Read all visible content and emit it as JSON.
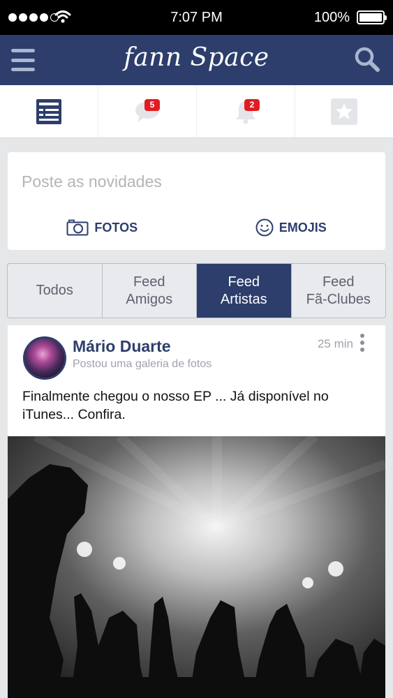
{
  "status_bar": {
    "time": "7:07 PM",
    "battery": "100%"
  },
  "header": {
    "title": "fann Space",
    "menu_icon": "hamburger-menu-icon",
    "search_icon": "search-icon"
  },
  "top_tabs": [
    {
      "name": "feed",
      "icon": "news-feed-icon",
      "badge": ""
    },
    {
      "name": "messages",
      "icon": "chat-bubble-icon",
      "badge": "5"
    },
    {
      "name": "notifications",
      "icon": "bell-icon",
      "badge": "2"
    },
    {
      "name": "favorites",
      "icon": "star-icon",
      "badge": ""
    }
  ],
  "composer": {
    "placeholder": "Poste as novidades",
    "photos_label": "FOTOS",
    "emojis_label": "EMOJIS"
  },
  "feed_filter": {
    "active": "Feed Artistas",
    "segments": [
      {
        "line1": "Todos",
        "line2": ""
      },
      {
        "line1": "Feed",
        "line2": "Amigos"
      },
      {
        "line1": "Feed",
        "line2": "Artistas"
      },
      {
        "line1": "Feed",
        "line2": "Fã-Clubes"
      }
    ]
  },
  "post": {
    "author": "Mário Duarte",
    "subtitle": "Postou uma galeria de fotos",
    "time_ago": "25 min",
    "text": "Finalmente chegou o nosso EP ... Já disponível no iTunes... Confira."
  },
  "colors": {
    "brand": "#2d3e6c",
    "badge": "#e21b23",
    "background": "#e6e7e9"
  }
}
